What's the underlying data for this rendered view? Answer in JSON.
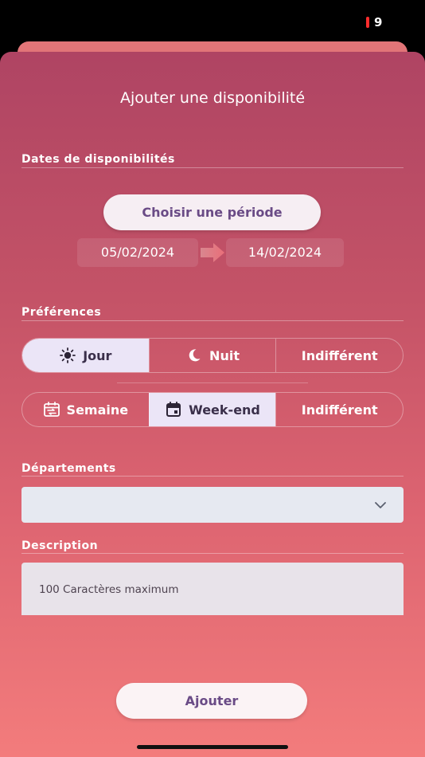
{
  "status": {
    "battery": "9"
  },
  "modal": {
    "title": "Ajouter une disponibilité"
  },
  "dates": {
    "section_label": "Dates de disponibilités",
    "choose_label": "Choisir une période",
    "start": "05/02/2024",
    "end": "14/02/2024"
  },
  "preferences": {
    "section_label": "Préférences",
    "time_of_day": [
      {
        "label": "Jour",
        "icon": "sun-icon",
        "selected": true
      },
      {
        "label": "Nuit",
        "icon": "moon-icon",
        "selected": false
      },
      {
        "label": "Indifférent",
        "icon": "",
        "selected": false
      }
    ],
    "week": [
      {
        "label": "Semaine",
        "icon": "calendar-repeat-icon",
        "selected": false
      },
      {
        "label": "Week-end",
        "icon": "calendar-icon",
        "selected": true
      },
      {
        "label": "Indifférent",
        "icon": "",
        "selected": false
      }
    ]
  },
  "departments": {
    "section_label": "Départements",
    "value": ""
  },
  "description": {
    "section_label": "Description",
    "placeholder": "100 Caractères maximum"
  },
  "submit": {
    "label": "Ajouter"
  },
  "colors": {
    "accent": "#6a4b86",
    "selected_segment": "#ebe5f7",
    "gradient_top": "#af4463",
    "gradient_bottom": "#f37c7c"
  }
}
